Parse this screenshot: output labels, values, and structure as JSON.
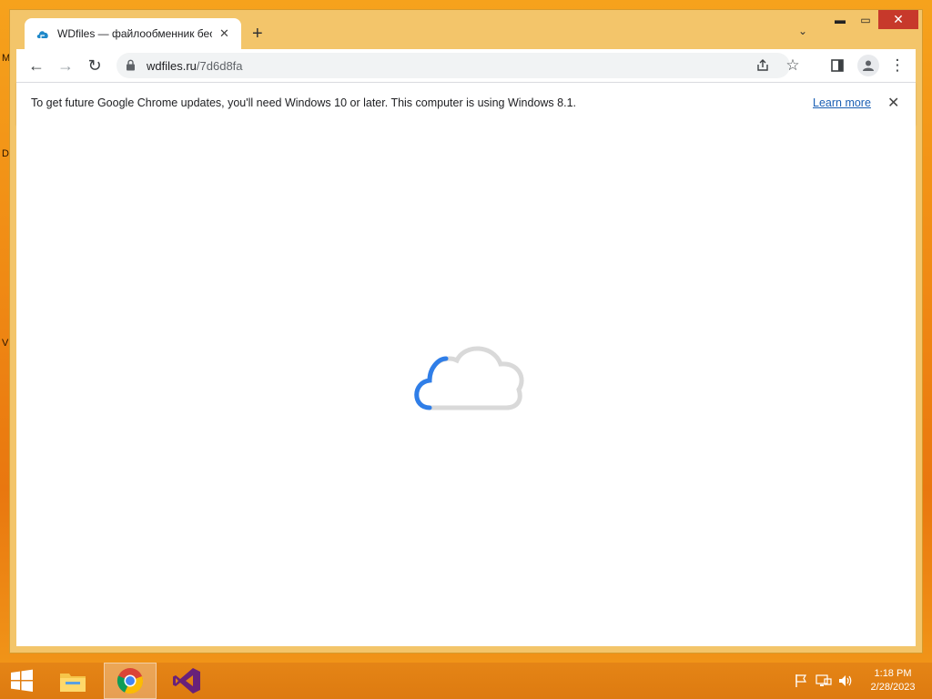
{
  "desktop": {
    "letters": [
      "M",
      "D",
      "V"
    ]
  },
  "window": {
    "min_glyph": "▬",
    "max_glyph": "▭",
    "close_glyph": "✕"
  },
  "tab": {
    "title": "WDfiles — файлообменник бесплатный",
    "close_glyph": "✕"
  },
  "newtab_glyph": "+",
  "tabsearch_glyph": "⌄",
  "toolbar": {
    "back_glyph": "←",
    "forward_glyph": "→",
    "reload_glyph": "↻",
    "url_host": "wdfiles.ru",
    "url_path": "/7d6d8fa",
    "bookmark_glyph": "☆",
    "menu_glyph": "⋮"
  },
  "infobar": {
    "message": "To get future Google Chrome updates, you'll need Windows 10 or later. This computer is using Windows 8.1.",
    "link": "Learn more",
    "close_glyph": "✕"
  },
  "taskbar": {
    "apps": [
      "start-icon",
      "file-explorer-icon",
      "chrome-icon",
      "visual-studio-icon"
    ],
    "tray_icons": [
      "flag-icon",
      "network-icon",
      "volume-icon"
    ],
    "time": "1:18 PM",
    "date": "2/28/2023"
  },
  "colors": {
    "accent": "#1a73e8",
    "taskbar": "#e07e12",
    "window_frame": "#f3c56a",
    "close_button": "#c7392b"
  }
}
